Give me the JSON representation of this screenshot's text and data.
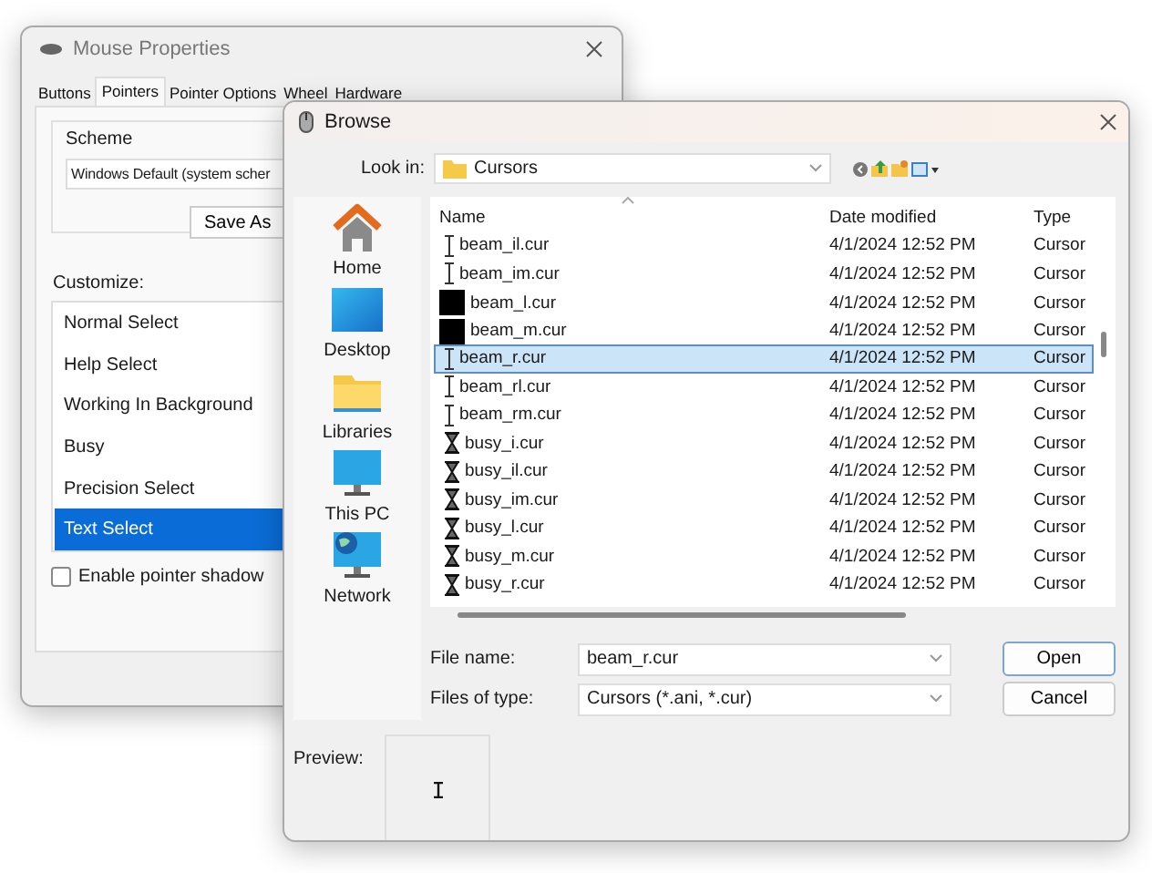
{
  "mouse_properties": {
    "title": "Mouse Properties",
    "tabs": [
      {
        "label": "Buttons",
        "selected": false
      },
      {
        "label": "Pointers",
        "selected": true
      },
      {
        "label": "Pointer Options",
        "selected": false
      },
      {
        "label": "Wheel",
        "selected": false
      },
      {
        "label": "Hardware",
        "selected": false
      }
    ],
    "scheme": {
      "label": "Scheme",
      "value": "Windows Default (system scher",
      "save_button": "Save As"
    },
    "customize": {
      "label": "Customize:",
      "items": [
        {
          "label": "Normal Select",
          "selected": false
        },
        {
          "label": "Help Select",
          "selected": false
        },
        {
          "label": "Working In Background",
          "selected": false
        },
        {
          "label": "Busy",
          "selected": false
        },
        {
          "label": "Precision Select",
          "selected": false
        },
        {
          "label": "Text Select",
          "selected": true
        }
      ]
    },
    "pointer_shadow": {
      "label": "Enable pointer shadow",
      "checked": false
    }
  },
  "browse": {
    "title": "Browse",
    "look_in": {
      "label": "Look in:",
      "value": "Cursors"
    },
    "places": [
      {
        "label": "Home",
        "kind": "home"
      },
      {
        "label": "Desktop",
        "kind": "desktop"
      },
      {
        "label": "Libraries",
        "kind": "libraries"
      },
      {
        "label": "This PC",
        "kind": "pc"
      },
      {
        "label": "Network",
        "kind": "network"
      }
    ],
    "file_list": {
      "columns": [
        "Name",
        "Date modified",
        "Type"
      ],
      "rows": [
        {
          "kind": "ibeam",
          "name": "beam_il.cur",
          "date": "4/1/2024 12:52 PM",
          "type": "Cursor",
          "selected": false
        },
        {
          "kind": "ibeam",
          "name": "beam_im.cur",
          "date": "4/1/2024 12:52 PM",
          "type": "Cursor",
          "selected": false
        },
        {
          "kind": "block",
          "name": "beam_l.cur",
          "date": "4/1/2024 12:52 PM",
          "type": "Cursor",
          "selected": false
        },
        {
          "kind": "block",
          "name": "beam_m.cur",
          "date": "4/1/2024 12:52 PM",
          "type": "Cursor",
          "selected": false
        },
        {
          "kind": "ibeam",
          "name": "beam_r.cur",
          "date": "4/1/2024 12:52 PM",
          "type": "Cursor",
          "selected": true
        },
        {
          "kind": "ibeam",
          "name": "beam_rl.cur",
          "date": "4/1/2024 12:52 PM",
          "type": "Cursor",
          "selected": false
        },
        {
          "kind": "ibeam",
          "name": "beam_rm.cur",
          "date": "4/1/2024 12:52 PM",
          "type": "Cursor",
          "selected": false
        },
        {
          "kind": "hourglass",
          "name": "busy_i.cur",
          "date": "4/1/2024 12:52 PM",
          "type": "Cursor",
          "selected": false
        },
        {
          "kind": "hourglass",
          "name": "busy_il.cur",
          "date": "4/1/2024 12:52 PM",
          "type": "Cursor",
          "selected": false
        },
        {
          "kind": "hourglass",
          "name": "busy_im.cur",
          "date": "4/1/2024 12:52 PM",
          "type": "Cursor",
          "selected": false
        },
        {
          "kind": "hourglass",
          "name": "busy_l.cur",
          "date": "4/1/2024 12:52 PM",
          "type": "Cursor",
          "selected": false
        },
        {
          "kind": "hourglass",
          "name": "busy_m.cur",
          "date": "4/1/2024 12:52 PM",
          "type": "Cursor",
          "selected": false
        },
        {
          "kind": "hourglass",
          "name": "busy_r.cur",
          "date": "4/1/2024 12:52 PM",
          "type": "Cursor",
          "selected": false
        }
      ]
    },
    "file_name": {
      "label": "File name:",
      "value": "beam_r.cur"
    },
    "file_type": {
      "label": "Files of type:",
      "value": "Cursors (*.ani, *.cur)"
    },
    "buttons": [
      "Open",
      "Cancel"
    ],
    "preview": {
      "label": "Preview:"
    }
  }
}
